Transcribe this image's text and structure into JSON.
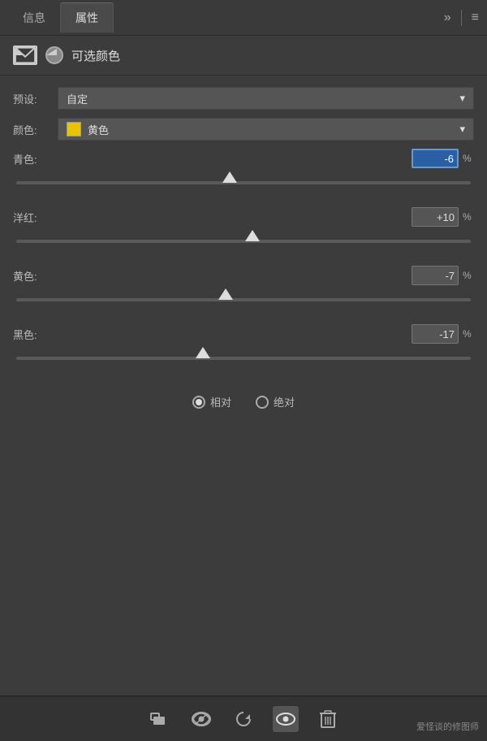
{
  "tabs": [
    {
      "id": "info",
      "label": "信息",
      "active": false
    },
    {
      "id": "properties",
      "label": "属性",
      "active": true
    }
  ],
  "tabActions": {
    "expandIcon": "»",
    "separator": "|",
    "menuIcon": "≡"
  },
  "sectionHeader": {
    "title": "可选颜色"
  },
  "presetRow": {
    "label": "预设:",
    "value": "自定"
  },
  "colorRow": {
    "label": "颜色:",
    "value": "黄色",
    "swatchColor": "#e8c400"
  },
  "sliders": [
    {
      "id": "cyan",
      "label": "青色:",
      "value": "-6",
      "highlighted": true,
      "thumbPercent": 47
    },
    {
      "id": "magenta",
      "label": "洋红:",
      "value": "+10",
      "highlighted": false,
      "thumbPercent": 52
    },
    {
      "id": "yellow",
      "label": "黄色:",
      "value": "-7",
      "highlighted": false,
      "thumbPercent": 46
    },
    {
      "id": "black",
      "label": "黑色:",
      "value": "-17",
      "highlighted": false,
      "thumbPercent": 41
    }
  ],
  "radioGroup": {
    "options": [
      {
        "id": "relative",
        "label": "相对",
        "checked": true
      },
      {
        "id": "absolute",
        "label": "绝对",
        "checked": false
      }
    ]
  },
  "toolbar": {
    "buttons": [
      {
        "id": "clip",
        "icon": "⬛",
        "symbol": "clip",
        "active": false
      },
      {
        "id": "visibility",
        "icon": "👁",
        "symbol": "eye-loop",
        "active": false
      },
      {
        "id": "reset",
        "icon": "↺",
        "symbol": "reset",
        "active": false
      },
      {
        "id": "eye",
        "icon": "👁",
        "symbol": "eye",
        "active": true
      },
      {
        "id": "delete",
        "icon": "🗑",
        "symbol": "trash",
        "active": false
      }
    ]
  },
  "watermark": "爱怪谈的修图师"
}
